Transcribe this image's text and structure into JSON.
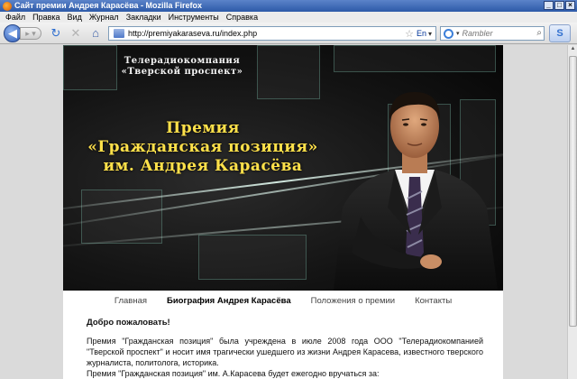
{
  "window": {
    "title": "Сайт премии Андрея Карасёва - Mozilla Firefox",
    "controls": [
      "_",
      "□",
      "×"
    ]
  },
  "menu": [
    "Файл",
    "Правка",
    "Вид",
    "Журнал",
    "Закладки",
    "Инструменты",
    "Справка"
  ],
  "toolbar": {
    "back_glyph": "◀",
    "forward_glyph": "▸ ▾",
    "reload_glyph": "↻",
    "stop_glyph": "✕",
    "home_glyph": "⌂",
    "url": "http://premiyakaraseva.ru/index.php",
    "star_glyph": "☆",
    "lang": "En",
    "drop_glyph": "▾",
    "search_placeholder": "Rambler",
    "search_drop": "▾",
    "search_glyph": "⌕",
    "skype_glyph": "S"
  },
  "banner": {
    "company_line1": "Телерадиокомпания",
    "company_line2": "«Тверской проспект»",
    "award_line1": "Премия",
    "award_line2": "«Гражданская позиция»",
    "award_line3": "им. Андрея Карасёва"
  },
  "nav": [
    {
      "label": "Главная",
      "active": false
    },
    {
      "label": "Биография Андрея Карасёва",
      "active": true
    },
    {
      "label": "Положения о премии",
      "active": false
    },
    {
      "label": "Контакты",
      "active": false
    }
  ],
  "content": {
    "welcome": "Добро пожаловать!",
    "para1": "Премия \"Гражданская позиция\" была учреждена в июле 2008 года ООО \"Телерадиокомпанией \"Тверской проспект\" и носит имя трагически ушедшего из жизни Андрея Карасева, известного тверского журналиста, политолога, историка.",
    "para2": "Премия \"Гражданская позиция\" им. А.Карасева будет ежегодно вручаться за:"
  },
  "colors": {
    "award_text": "#ffe14a",
    "titlebar": "#2d5aa8"
  }
}
